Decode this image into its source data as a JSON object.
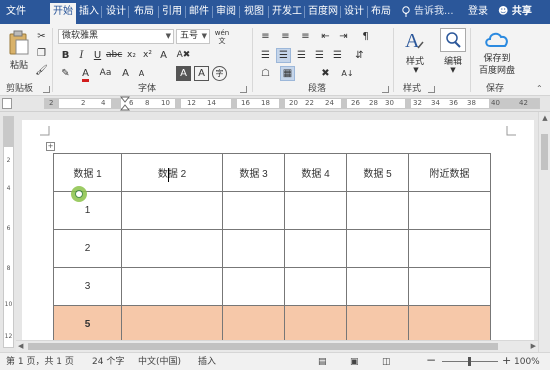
{
  "tabs": [
    "文件",
    "开始",
    "插入",
    "设计",
    "布局",
    "引用",
    "邮件",
    "审阅",
    "视图",
    "开发工",
    "百度网",
    "设计",
    "布局"
  ],
  "tell_me": "告诉我...",
  "login": "登录",
  "share": "共享",
  "ribbon": {
    "paste": "粘贴",
    "font_name": "微软雅黑",
    "font_size": "五号",
    "wen": "wén",
    "style": "样式",
    "edit": "编辑",
    "save_to": "保存到",
    "baidu_disk": "百度网盘",
    "groups": {
      "clipboard": "剪贴板",
      "font": "字体",
      "paragraph": "段落",
      "styles": "样式",
      "save": "保存"
    }
  },
  "ruler_numbers": [
    "2",
    "2",
    "4",
    "6",
    "8",
    "10",
    "12",
    "14",
    "16",
    "18",
    "20",
    "22",
    "24",
    "26",
    "28",
    "30",
    "32",
    "34",
    "36",
    "38",
    "40",
    "42"
  ],
  "table": {
    "header": [
      "数据 1",
      "数据 2",
      "数据 3",
      "数据 4",
      "数据 5",
      "附近数据"
    ],
    "rows": [
      [
        "1",
        "",
        "",
        "",
        "",
        ""
      ],
      [
        "2",
        "",
        "",
        "",
        "",
        ""
      ],
      [
        "3",
        "",
        "",
        "",
        "",
        ""
      ],
      [
        "5",
        "",
        "",
        "",
        "",
        ""
      ]
    ]
  },
  "status": {
    "page": "第 1 页，共 1 页",
    "words": "24 个字",
    "lang": "中文(中国)",
    "mode": "插入",
    "zoom": "100%"
  },
  "colors": {
    "accent": "#2b579a",
    "row_highlight": "#f6c8a9",
    "red": "#d21d1d"
  }
}
